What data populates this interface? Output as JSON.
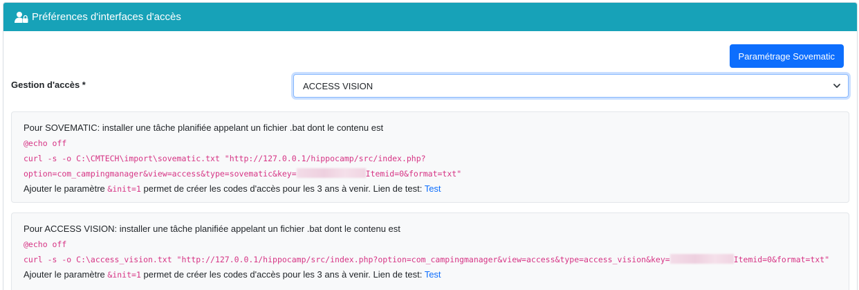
{
  "header": {
    "title": "Préférences d'interfaces d'accès",
    "icon": "user-lock-icon"
  },
  "toolbar": {
    "sovematic_button_label": "Paramétrage Sovematic"
  },
  "access_form": {
    "label": "Gestion d'accès *",
    "selected_value": "ACCESS VISION"
  },
  "sovematic_box": {
    "intro": "Pour SOVEMATIC: installer une tâche planifiée appelant un fichier .bat dont le contenu est",
    "code_echo": "@echo off",
    "code_curl_line1": "curl -s -o C:\\CMTECH\\import\\sovematic.txt \"http://127.0.0.1/hippocamp/src/index.php?",
    "code_curl_line2_pre": "option=com_campingmanager&view=access&type=sovematic&key=",
    "code_curl_line2_post": "Itemid=0&format=txt\"",
    "param_text_pre": "Ajouter le paramètre ",
    "param_code": "&init=1",
    "param_text_post": " permet de créer les codes d'accès pour les 3 ans à venir. Lien de test: ",
    "test_link": "Test"
  },
  "access_vision_box": {
    "intro": "Pour ACCESS VISION: installer une tâche planifiée appelant un fichier .bat dont le contenu est",
    "code_echo": "@echo off",
    "code_curl_pre": "curl -s -o C:\\access_vision.txt \"http://127.0.0.1/hippocamp/src/index.php?option=com_campingmanager&view=access&type=access_vision&key=",
    "code_curl_post": "Itemid=0&format=txt\"",
    "param_text_pre": "Ajouter le paramètre ",
    "param_code": "&init=1",
    "param_text_post": " permet de créer les codes d'accès pour les 3 ans à venir. Lien de test: ",
    "test_link": "Test"
  },
  "colors": {
    "header_bg": "#17a2b8",
    "primary": "#0d6efd",
    "code": "#d63384",
    "box_bg": "#f8f9fa"
  }
}
